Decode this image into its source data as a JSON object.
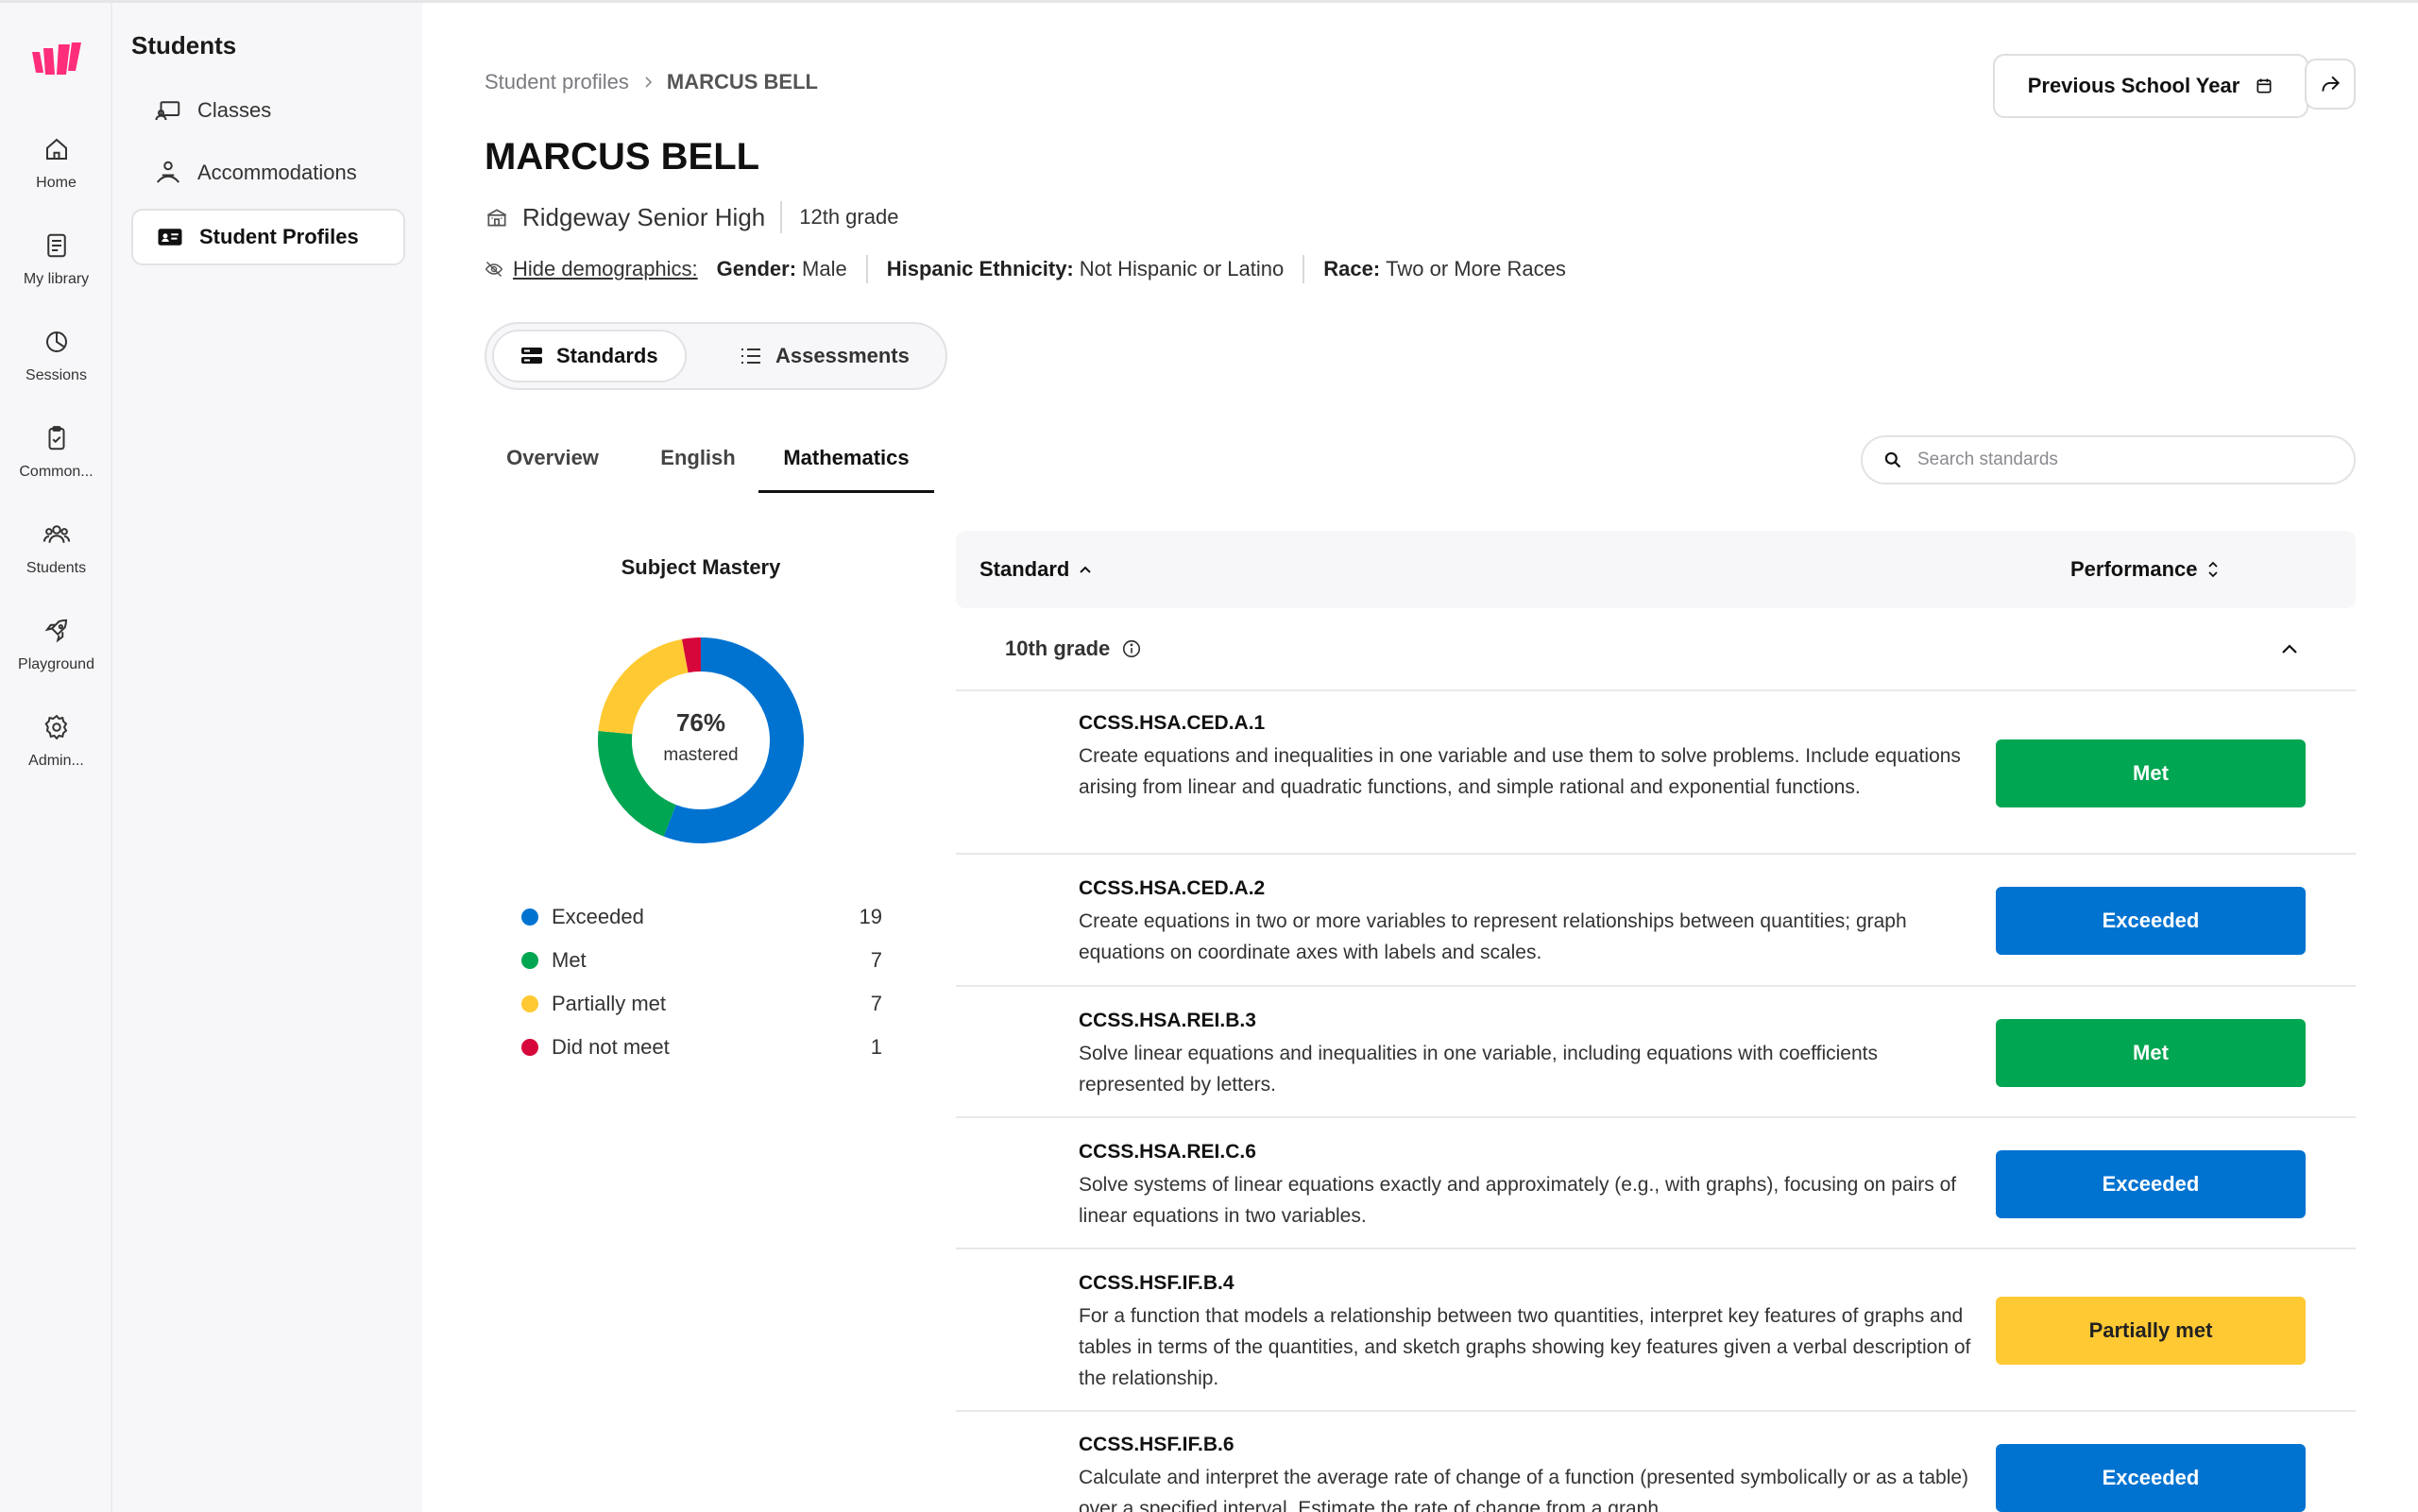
{
  "rail": {
    "items": [
      {
        "label": "Home",
        "icon": "home-icon"
      },
      {
        "label": "My library",
        "icon": "library-icon"
      },
      {
        "label": "Sessions",
        "icon": "sessions-icon"
      },
      {
        "label": "Common...",
        "icon": "clipboard-icon"
      },
      {
        "label": "Students",
        "icon": "students-icon"
      },
      {
        "label": "Playground",
        "icon": "rocket-icon"
      },
      {
        "label": "Admin...",
        "icon": "gear-icon"
      }
    ]
  },
  "subnav": {
    "title": "Students",
    "items": [
      {
        "label": "Classes",
        "icon": "classes-icon"
      },
      {
        "label": "Accommodations",
        "icon": "accommodations-icon"
      },
      {
        "label": "Student Profiles",
        "icon": "id-card-icon"
      }
    ]
  },
  "breadcrumb": {
    "parent": "Student profiles",
    "current": "MARCUS BELL"
  },
  "header": {
    "prev_year_label": "Previous School Year"
  },
  "student": {
    "name": "MARCUS BELL",
    "school": "Ridgeway Senior High",
    "grade": "12th grade",
    "hide_demographics": "Hide demographics:",
    "gender_label": "Gender:",
    "gender_value": "Male",
    "ethnicity_label": "Hispanic Ethnicity:",
    "ethnicity_value": "Not Hispanic or Latino",
    "race_label": "Race:",
    "race_value": "Two or More Races"
  },
  "segments": {
    "standards": "Standards",
    "assessments": "Assessments"
  },
  "tabs": [
    "Overview",
    "English",
    "Mathematics"
  ],
  "search": {
    "placeholder": "Search standards"
  },
  "mastery": {
    "title": "Subject Mastery",
    "percent": "76%",
    "subtitle": "mastered",
    "colors": {
      "exceeded": "#0073d1",
      "met": "#00a651",
      "partial": "#ffc933",
      "didnot": "#d6083b"
    },
    "legend": [
      {
        "label": "Exceeded",
        "count": "19"
      },
      {
        "label": "Met",
        "count": "7"
      },
      {
        "label": "Partially met",
        "count": "7"
      },
      {
        "label": "Did not meet",
        "count": "1"
      }
    ]
  },
  "table": {
    "col_standard": "Standard",
    "col_performance": "Performance",
    "group": "10th grade",
    "rows": [
      {
        "code": "CCSS.HSA.CED.A.1",
        "desc": "Create equations and inequalities in one variable and use them to solve problems. Include equations arising from linear and quadratic functions, and simple rational and exponential functions.",
        "perf": "Met"
      },
      {
        "code": "CCSS.HSA.CED.A.2",
        "desc": "Create equations in two or more variables to represent relationships between quantities; graph equations on coordinate axes with labels and scales.",
        "perf": "Exceeded"
      },
      {
        "code": "CCSS.HSA.REI.B.3",
        "desc": "Solve linear equations and inequalities in one variable, including equations with coefficients represented by letters.",
        "perf": "Met"
      },
      {
        "code": "CCSS.HSA.REI.C.6",
        "desc": "Solve systems of linear equations exactly and approximately (e.g., with graphs), focusing on pairs of linear equations in two variables.",
        "perf": "Exceeded"
      },
      {
        "code": "CCSS.HSF.IF.B.4",
        "desc": "For a function that models a relationship between two quantities, interpret key features of graphs and tables in terms of the quantities, and sketch graphs showing key features given a verbal description of the relationship.",
        "perf": "Partially met"
      },
      {
        "code": "CCSS.HSF.IF.B.6",
        "desc": "Calculate and interpret the average rate of change of a function (presented symbolically or as a table) over a specified interval. Estimate the rate of change from a graph.",
        "perf": "Exceeded"
      }
    ]
  }
}
